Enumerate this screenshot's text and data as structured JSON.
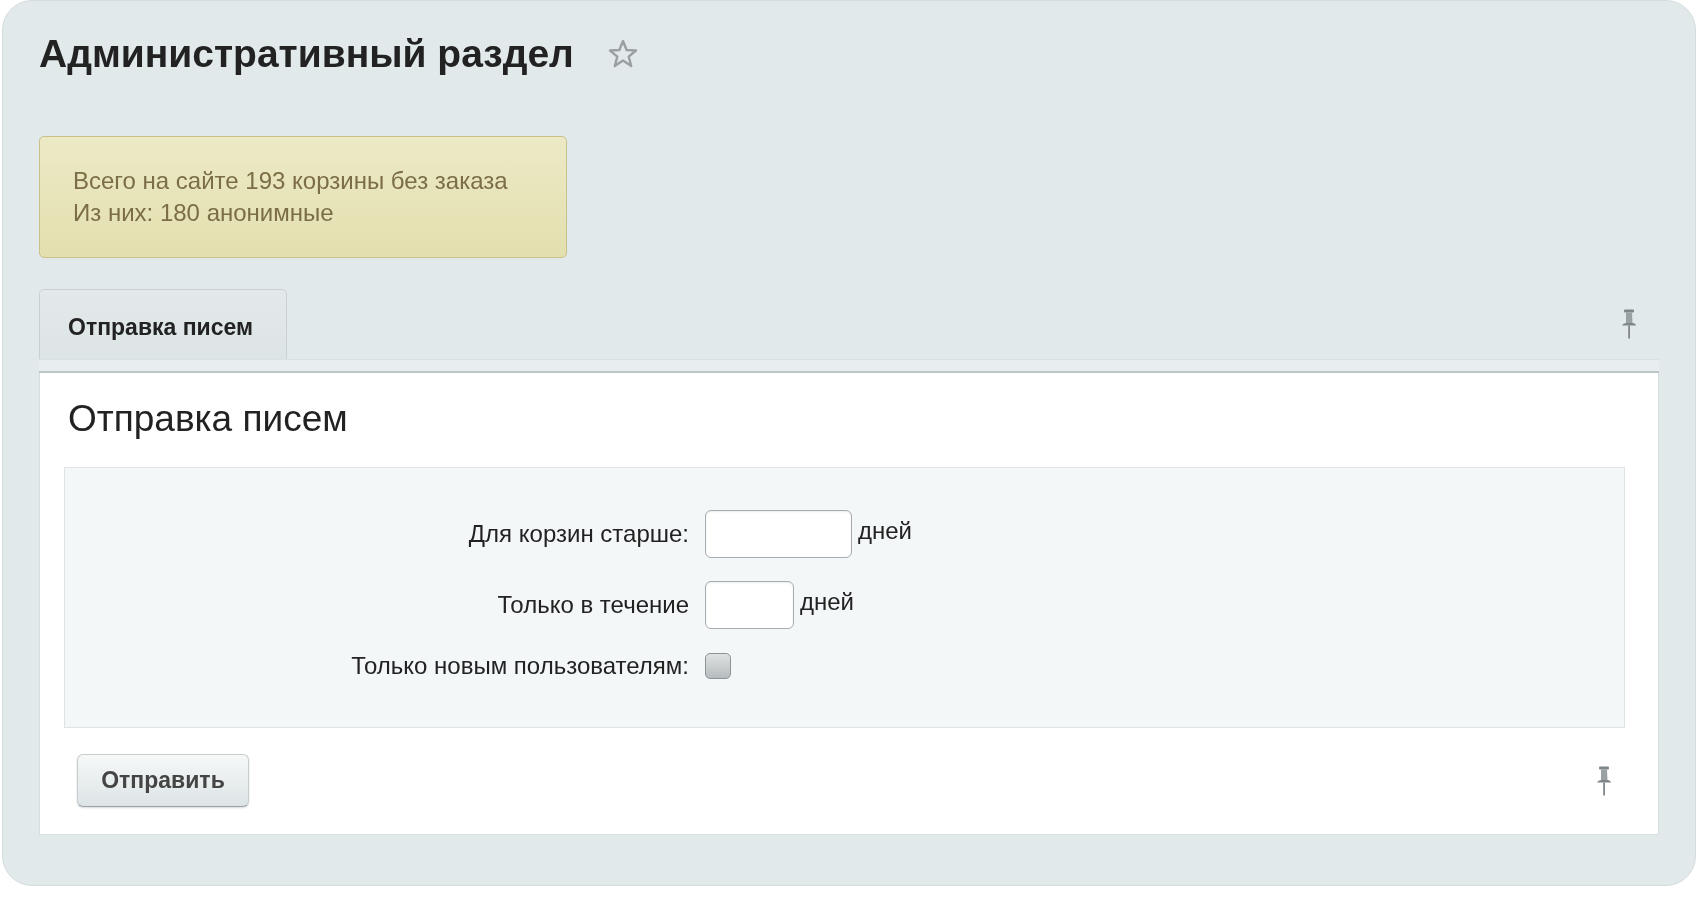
{
  "header": {
    "title": "Административный раздел",
    "starred": false
  },
  "notice": {
    "lines": [
      "Всего на сайте 193 корзины без заказа",
      "Из них: 180 анонимные"
    ]
  },
  "tabs": [
    {
      "label": "Отправка писем",
      "selected": true
    }
  ],
  "form": {
    "title": "Отправка писем",
    "fields": [
      {
        "kind": "input",
        "label": "Для корзин старше:",
        "unit": "дней"
      },
      {
        "kind": "input",
        "label": "Только в течение",
        "unit": "дней"
      },
      {
        "kind": "checkbox",
        "label": "Только новым пользователям:",
        "checked": false
      }
    ],
    "submit_button": "Отправить"
  }
}
